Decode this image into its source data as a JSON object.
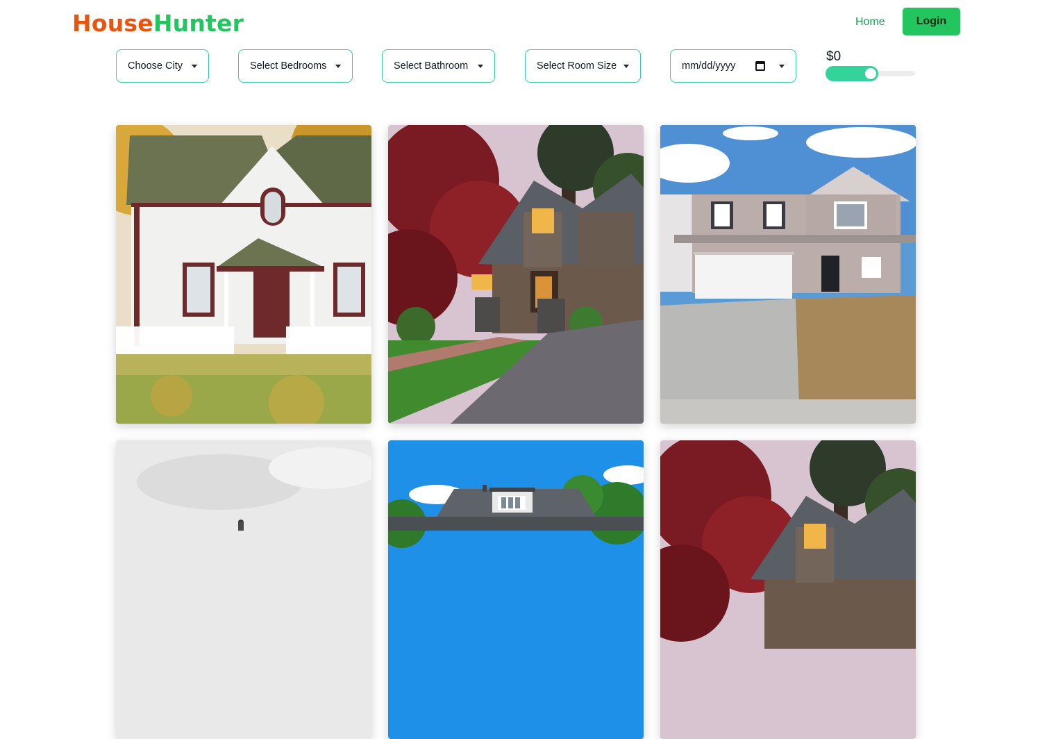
{
  "header": {
    "logo_part1": "House",
    "logo_part2": "Hunter",
    "nav_home": "Home",
    "login_label": "Login"
  },
  "filters": {
    "city": "Choose City",
    "bedrooms": "Select Bedrooms",
    "bathroom": "Select Bathroom",
    "room_size": "Select Room Size",
    "date_placeholder": "mm/dd/yyyy",
    "price": "$0"
  },
  "listings": [
    {
      "image": "white-cottage-autumn"
    },
    {
      "image": "craftsman-house-red-maple-dusk"
    },
    {
      "image": "gray-two-story-garage"
    },
    {
      "image": "house-overcast-sky"
    },
    {
      "image": "gray-house-blue-sky"
    },
    {
      "image": "craftsman-house-red-maple-dusk"
    }
  ],
  "colors": {
    "logo_orange": "#e8550f",
    "logo_green": "#22c55e",
    "accent": "#34d399",
    "border": "#2dd4a0"
  }
}
